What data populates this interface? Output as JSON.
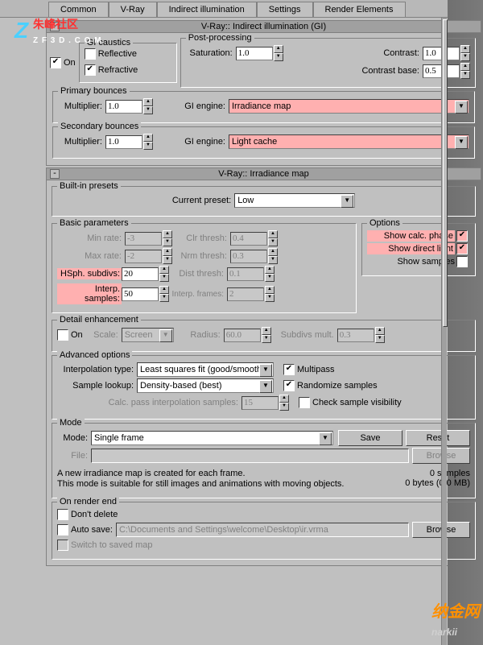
{
  "tabs": [
    "Common",
    "V-Ray",
    "Indirect illumination",
    "Settings",
    "Render Elements"
  ],
  "wm_top_cn": "朱峰社区",
  "wm_top_sub": "Z F 3 D . C O M",
  "rollout_gi": "V-Ray:: Indirect illumination (GI)",
  "on": "On",
  "gi_caustics": "GI caustics",
  "reflective": "Reflective",
  "refractive": "Refractive",
  "post": "Post-processing",
  "saturation": "Saturation:",
  "sat_val": "1.0",
  "contrast": "Contrast:",
  "con_val": "1.0",
  "contrast_base": "Contrast base:",
  "con_base_val": "0.5",
  "primary": "Primary bounces",
  "secondary": "Secondary bounces",
  "multiplier": "Multiplier:",
  "mult_val": "1.0",
  "gi_engine": "GI engine:",
  "engine_primary": "Irradiance map",
  "engine_secondary": "Light cache",
  "rollout_irr": "V-Ray:: Irradiance map",
  "builtin": "Built-in presets",
  "current_preset": "Current preset:",
  "preset_val": "Low",
  "basic": "Basic parameters",
  "options": "Options",
  "min_rate": "Min rate:",
  "min_val": "-3",
  "max_rate": "Max rate:",
  "max_val": "-2",
  "hsph": "HSph. subdivs:",
  "hsph_val": "20",
  "interp": "Interp. samples:",
  "interp_val": "50",
  "clr": "Clr thresh:",
  "clr_val": "0.4",
  "nrm": "Nrm thresh:",
  "nrm_val": "0.3",
  "dist": "Dist thresh:",
  "dist_val": "0.1",
  "iframes": "Interp. frames:",
  "iframes_val": "2",
  "show_calc": "Show calc. phase",
  "show_direct": "Show direct light",
  "show_samples": "Show samples",
  "detail": "Detail enhancement",
  "scale": "Scale:",
  "scale_val": "Screen",
  "radius": "Radius:",
  "radius_val": "60.0",
  "subdivs_mult": "Subdivs mult.",
  "subdivs_val": "0.3",
  "adv": "Advanced options",
  "interp_type": "Interpolation type:",
  "interp_type_val": "Least squares fit (good/smooth",
  "sample_lookup": "Sample lookup:",
  "sample_lookup_val": "Density-based (best)",
  "calc_pass": "Calc. pass interpolation samples:",
  "calc_pass_val": "15",
  "multipass": "Multipass",
  "randomize": "Randomize samples",
  "check_vis": "Check sample visibility",
  "mode_g": "Mode",
  "mode": "Mode:",
  "mode_val": "Single frame",
  "save": "Save",
  "reset": "Reset",
  "file": "File:",
  "browse": "Browse",
  "hint": "A new irradiance map is created for each frame.\nThis mode is suitable for still images and animations with moving objects.",
  "samples_info": "0 samples",
  "bytes_info": "0 bytes (0.0 MB)",
  "on_render": "On render end",
  "dont_delete": "Don't delete",
  "auto_save": "Auto save:",
  "auto_path": "C:\\Documents and Settings\\welcome\\Desktop\\ir.vrma",
  "switch_saved": "Switch to saved map",
  "wm_bottom": "纳金网",
  "wm_suffix": "narkii"
}
